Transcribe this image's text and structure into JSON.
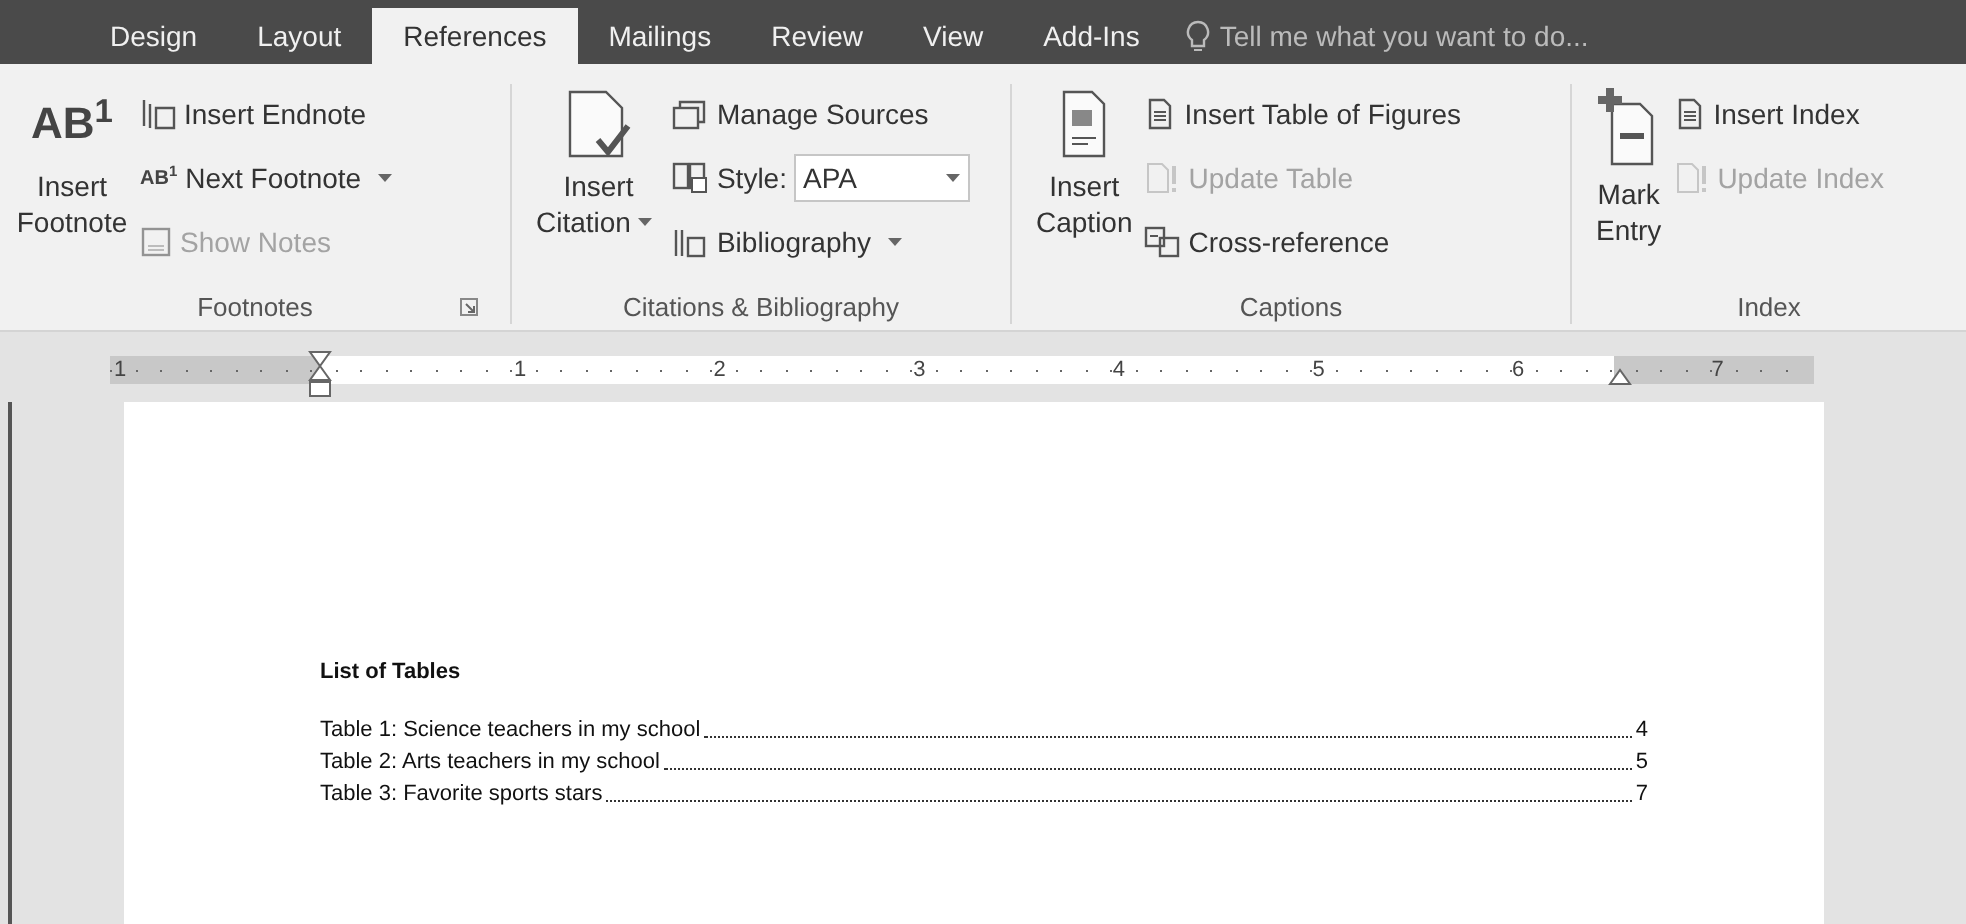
{
  "tabs": [
    {
      "label": "Design",
      "selected": false
    },
    {
      "label": "Layout",
      "selected": false
    },
    {
      "label": "References",
      "selected": true
    },
    {
      "label": "Mailings",
      "selected": false
    },
    {
      "label": "Review",
      "selected": false
    },
    {
      "label": "View",
      "selected": false
    },
    {
      "label": "Add-Ins",
      "selected": false
    }
  ],
  "tell_me": {
    "placeholder": "Tell me what you want to do..."
  },
  "ribbon": {
    "groups": [
      {
        "name": "Footnotes",
        "launcher": true,
        "large": {
          "lines": [
            "Insert",
            "Footnote"
          ],
          "icon_text": "AB$^{1}$"
        },
        "small": [
          {
            "kind": "button",
            "label": "Insert Endnote",
            "disabled": false
          },
          {
            "kind": "button",
            "label": "Next Footnote",
            "icon_text": "AB$^{1}$",
            "disabled": false,
            "dropdown": true
          },
          {
            "kind": "button",
            "label": "Show Notes",
            "disabled": true
          }
        ]
      },
      {
        "name": "Citations & Bibliography",
        "large": {
          "lines": [
            "Insert",
            "Citation"
          ],
          "dropdown": true
        },
        "small": [
          {
            "kind": "button",
            "label": "Manage Sources",
            "disabled": false
          },
          {
            "kind": "select",
            "label": "Style:",
            "value": "APA"
          },
          {
            "kind": "button",
            "label": "Bibliography",
            "disabled": false,
            "dropdown": true
          }
        ]
      },
      {
        "name": "Captions",
        "large": {
          "lines": [
            "Insert",
            "Caption"
          ]
        },
        "small": [
          {
            "kind": "button",
            "label": "Insert Table of Figures",
            "disabled": false
          },
          {
            "kind": "button",
            "label": "Update Table",
            "disabled": true
          },
          {
            "kind": "button",
            "label": "Cross-reference",
            "disabled": false
          }
        ]
      },
      {
        "name": "Index",
        "large": {
          "lines": [
            "Mark",
            "Entry"
          ]
        },
        "small": [
          {
            "kind": "button",
            "label": "Insert Index",
            "disabled": false
          },
          {
            "kind": "button",
            "label": "Update Index",
            "disabled": true
          }
        ]
      }
    ]
  },
  "ruler": {
    "labels": [
      "1",
      "1",
      "2",
      "3",
      "4",
      "5",
      "6",
      "7"
    ]
  },
  "document": {
    "heading": "List of Tables",
    "entries": [
      {
        "title": "Table 1: Science teachers in my school",
        "page": "4"
      },
      {
        "title": "Table 2: Arts teachers in my school",
        "page": "5"
      },
      {
        "title": "Table 3: Favorite sports stars",
        "page": "7"
      }
    ]
  }
}
